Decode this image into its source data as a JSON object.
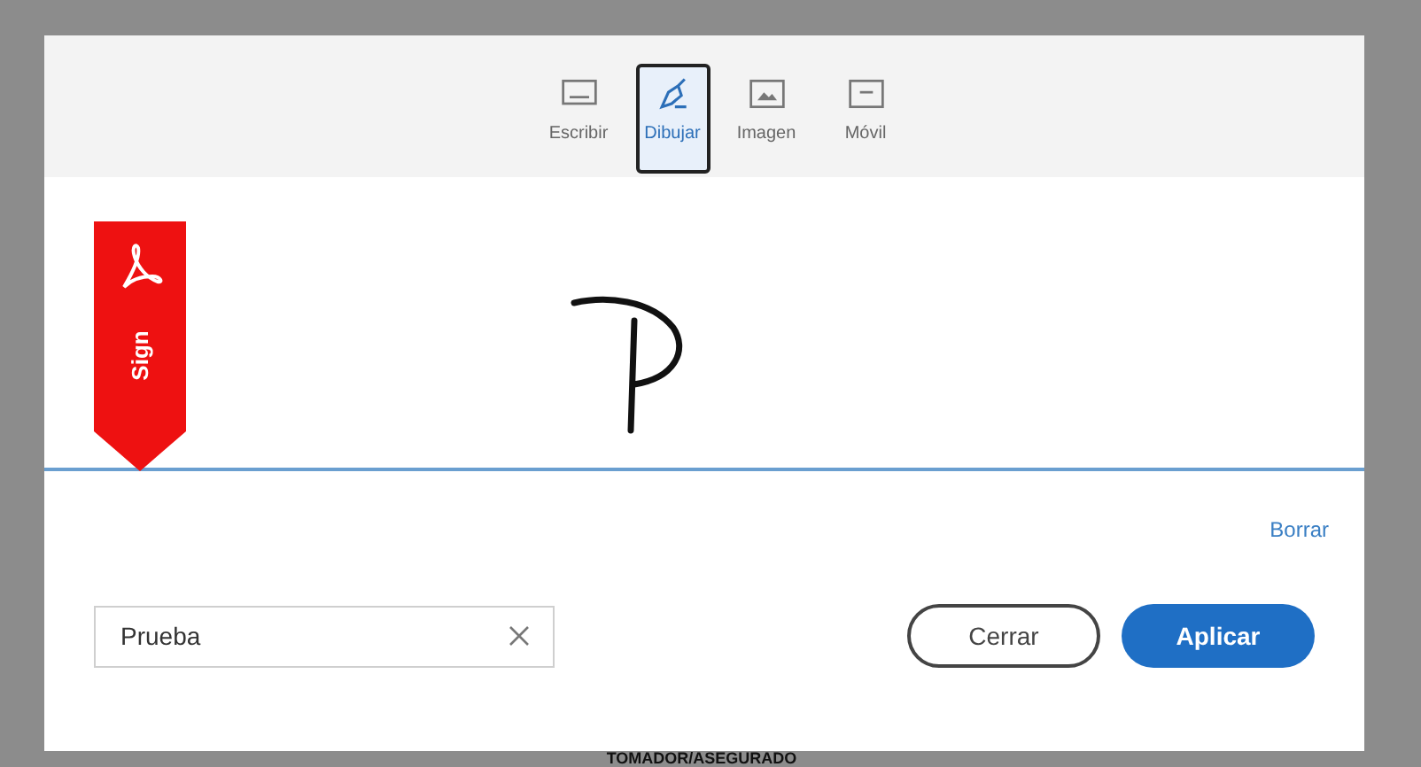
{
  "tabs": [
    {
      "label": "Escribir",
      "kind": "type",
      "selected": false
    },
    {
      "label": "Dibujar",
      "kind": "draw",
      "selected": true
    },
    {
      "label": "Imagen",
      "kind": "image",
      "selected": false
    },
    {
      "label": "Móvil",
      "kind": "mobile",
      "selected": false
    }
  ],
  "sign_marker": {
    "label": "Sign"
  },
  "clear_link": "Borrar",
  "name_field": {
    "value": "Prueba"
  },
  "buttons": [
    {
      "label": "Cerrar",
      "kind": "secondary"
    },
    {
      "label": "Aplicar",
      "kind": "primary"
    }
  ],
  "background_text": "TOMADOR/ASEGURADO"
}
